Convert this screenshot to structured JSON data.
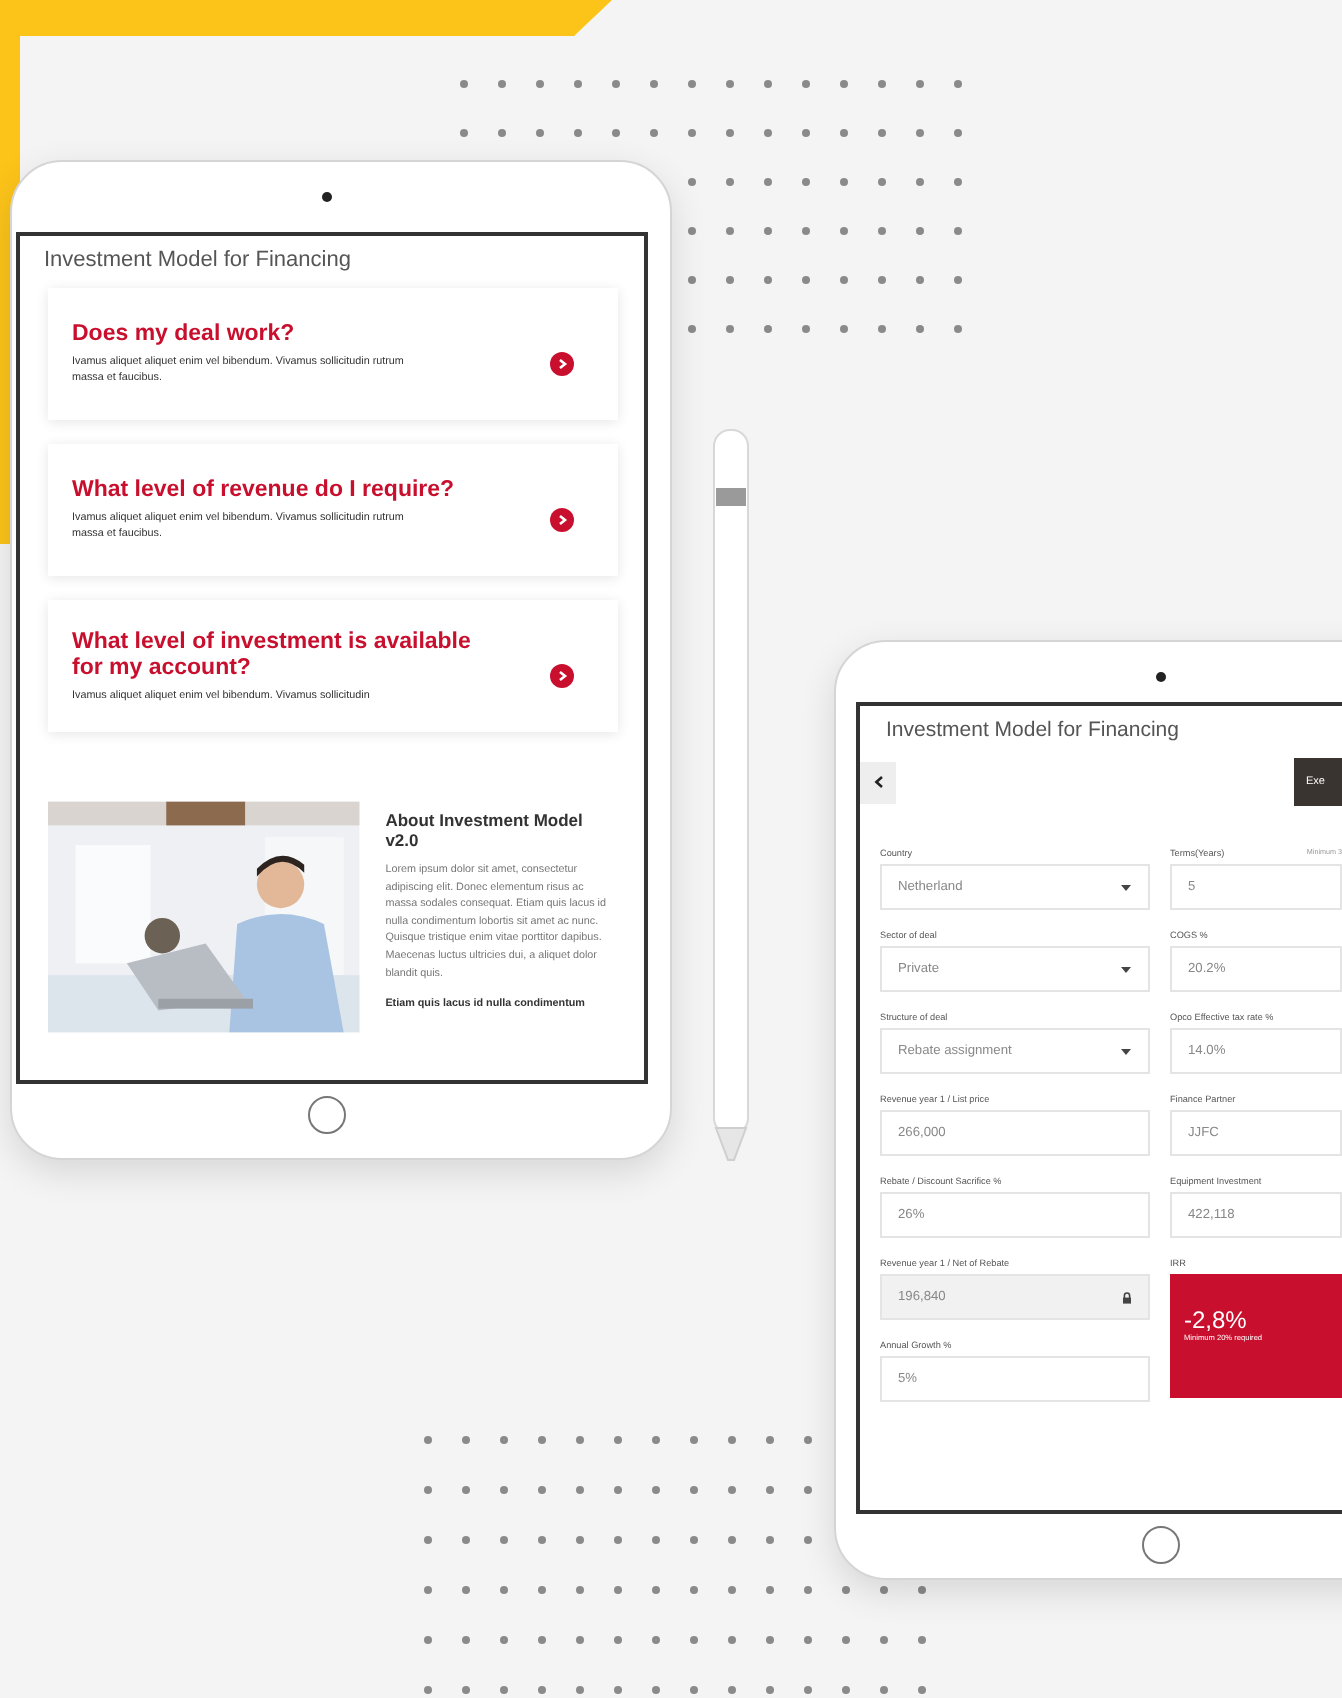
{
  "left_tablet": {
    "title": "Investment Model for Financing",
    "cards": [
      {
        "title": "Does my deal work?",
        "body": "Ivamus aliquet aliquet enim vel bibendum. Vivamus sollicitudin rutrum massa et faucibus."
      },
      {
        "title": "What level of revenue do I require?",
        "body": "Ivamus aliquet aliquet enim vel bibendum. Vivamus sollicitudin rutrum massa et faucibus."
      },
      {
        "title": "What level of investment is available for my account?",
        "body": "Ivamus aliquet aliquet enim vel bibendum. Vivamus sollicitudin"
      }
    ],
    "about": {
      "heading": "About Investment Model v2.0",
      "body": "Lorem ipsum dolor sit amet, consectetur adipiscing elit. Donec elementum risus ac massa sodales consequat. Etiam quis lacus id nulla condimentum lobortis sit amet ac nunc. Quisque tristique enim vitae porttitor dapibus. Maecenas luctus ultricies dui, a aliquet dolor blandit quis.",
      "footer": "Etiam quis lacus id nulla condimentum"
    }
  },
  "right_tablet": {
    "title": "Investment Model for Financing",
    "action_button": "Exe",
    "left_fields": [
      {
        "kind": "select",
        "label": "Country",
        "value": "Netherland"
      },
      {
        "kind": "select",
        "label": "Sector of deal",
        "value": "Private"
      },
      {
        "kind": "select",
        "label": "Structure of deal",
        "value": "Rebate assignment"
      },
      {
        "kind": "text",
        "label": "Revenue year 1 / List price",
        "value": "266,000"
      },
      {
        "kind": "text",
        "label": "Rebate / Discount Sacrifice %",
        "value": "26%"
      },
      {
        "kind": "locked",
        "label": "Revenue year 1 / Net of Rebate",
        "value": "196,840"
      },
      {
        "kind": "text",
        "label": "Annual Growth %",
        "value": "5%"
      }
    ],
    "right_fields": [
      {
        "kind": "text",
        "label": "Terms(Years)",
        "hint": "Minimum 3",
        "value": "5"
      },
      {
        "kind": "text",
        "label": "COGS %",
        "value": "20.2%"
      },
      {
        "kind": "text",
        "label": "Opco Effective tax rate %",
        "value": "14.0%"
      },
      {
        "kind": "text",
        "label": "Finance Partner",
        "value": "JJFC"
      },
      {
        "kind": "text",
        "label": "Equipment Investment",
        "value": "422,118"
      },
      {
        "kind": "result",
        "label": "IRR",
        "value": "-2,8%",
        "note": "Minimum 20% required"
      }
    ]
  }
}
